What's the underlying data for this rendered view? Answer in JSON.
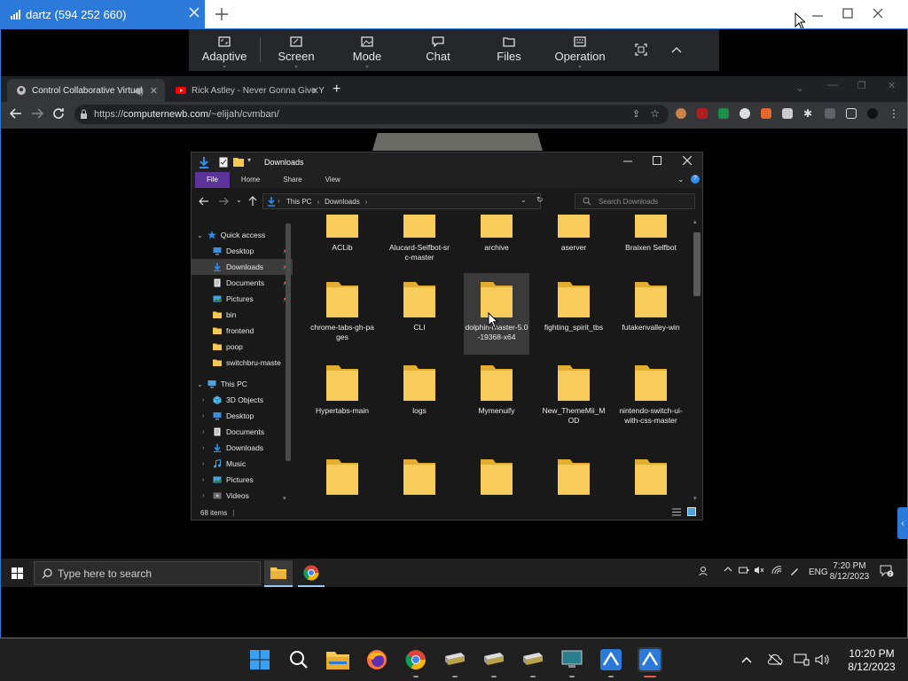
{
  "remote_app": {
    "tab_title": "dartz (594 252 660)",
    "toolbar": [
      {
        "label": "Adaptive",
        "icon": "adaptive-icon"
      },
      {
        "label": "Screen",
        "icon": "screen-icon"
      },
      {
        "label": "Mode",
        "icon": "mode-icon"
      },
      {
        "label": "Chat",
        "icon": "chat-icon"
      },
      {
        "label": "Files",
        "icon": "files-icon"
      },
      {
        "label": "Operation",
        "icon": "operation-icon"
      }
    ]
  },
  "browser": {
    "tabs": [
      {
        "title": "Control Collaborative Virtual",
        "active": true
      },
      {
        "title": "Rick Astley - Never Gonna Give Y",
        "active": false
      }
    ],
    "url_prefix": "https://",
    "url_host": "computernewb.com",
    "url_path": "/~elijah/cvmban/"
  },
  "explorer": {
    "title": "Downloads",
    "ribbon": [
      "File",
      "Home",
      "Share",
      "View"
    ],
    "breadcrumb": [
      "This PC",
      "Downloads"
    ],
    "search_placeholder": "Search Downloads",
    "status": "68 items",
    "nav": {
      "quick_access": "Quick access",
      "quick_items": [
        {
          "label": "Desktop",
          "icon": "desktop-icon",
          "pinned": true
        },
        {
          "label": "Downloads",
          "icon": "downloads-icon",
          "pinned": true,
          "selected": true
        },
        {
          "label": "Documents",
          "icon": "documents-icon",
          "pinned": true
        },
        {
          "label": "Pictures",
          "icon": "pictures-icon",
          "pinned": true
        },
        {
          "label": "bin",
          "icon": "folder-icon"
        },
        {
          "label": "frontend",
          "icon": "folder-icon"
        },
        {
          "label": "poop",
          "icon": "folder-icon"
        },
        {
          "label": "switchbru-maste",
          "icon": "folder-icon"
        }
      ],
      "this_pc": "This PC",
      "pc_items": [
        {
          "label": "3D Objects",
          "icon": "3d-objects-icon"
        },
        {
          "label": "Desktop",
          "icon": "desktop-icon"
        },
        {
          "label": "Documents",
          "icon": "documents-icon"
        },
        {
          "label": "Downloads",
          "icon": "downloads-icon"
        },
        {
          "label": "Music",
          "icon": "music-icon"
        },
        {
          "label": "Pictures",
          "icon": "pictures-icon"
        },
        {
          "label": "Videos",
          "icon": "videos-icon"
        }
      ]
    },
    "folders": [
      {
        "name": "ACLib"
      },
      {
        "name": "Alucard-Selfbot-src-master"
      },
      {
        "name": "archive"
      },
      {
        "name": "aserver"
      },
      {
        "name": "Braixen Selfbot"
      },
      {
        "name": "chrome-tabs-gh-pages"
      },
      {
        "name": "CLI"
      },
      {
        "name": "dolphin-master-5.0-19368-x64",
        "selected": true
      },
      {
        "name": "fighting_spirit_tbs"
      },
      {
        "name": "futakenvalley-win"
      },
      {
        "name": "Hypertabs-main"
      },
      {
        "name": "logs"
      },
      {
        "name": "Mymenuify"
      },
      {
        "name": "New_ThemeMii_MOD"
      },
      {
        "name": "nintendo-switch-ui-with-css-master"
      },
      {
        "name": ""
      },
      {
        "name": ""
      },
      {
        "name": ""
      },
      {
        "name": ""
      },
      {
        "name": ""
      }
    ]
  },
  "vm_taskbar": {
    "search_placeholder": "Type here to search",
    "lang": "ENG",
    "time": "7:20 PM",
    "date": "8/12/2023"
  },
  "host_taskbar": {
    "time": "10:20 PM",
    "date": "8/12/2023"
  },
  "colors": {
    "accent": "#2b79d8",
    "folder": "#f5c94f",
    "ribbon_file": "#5b3399"
  }
}
